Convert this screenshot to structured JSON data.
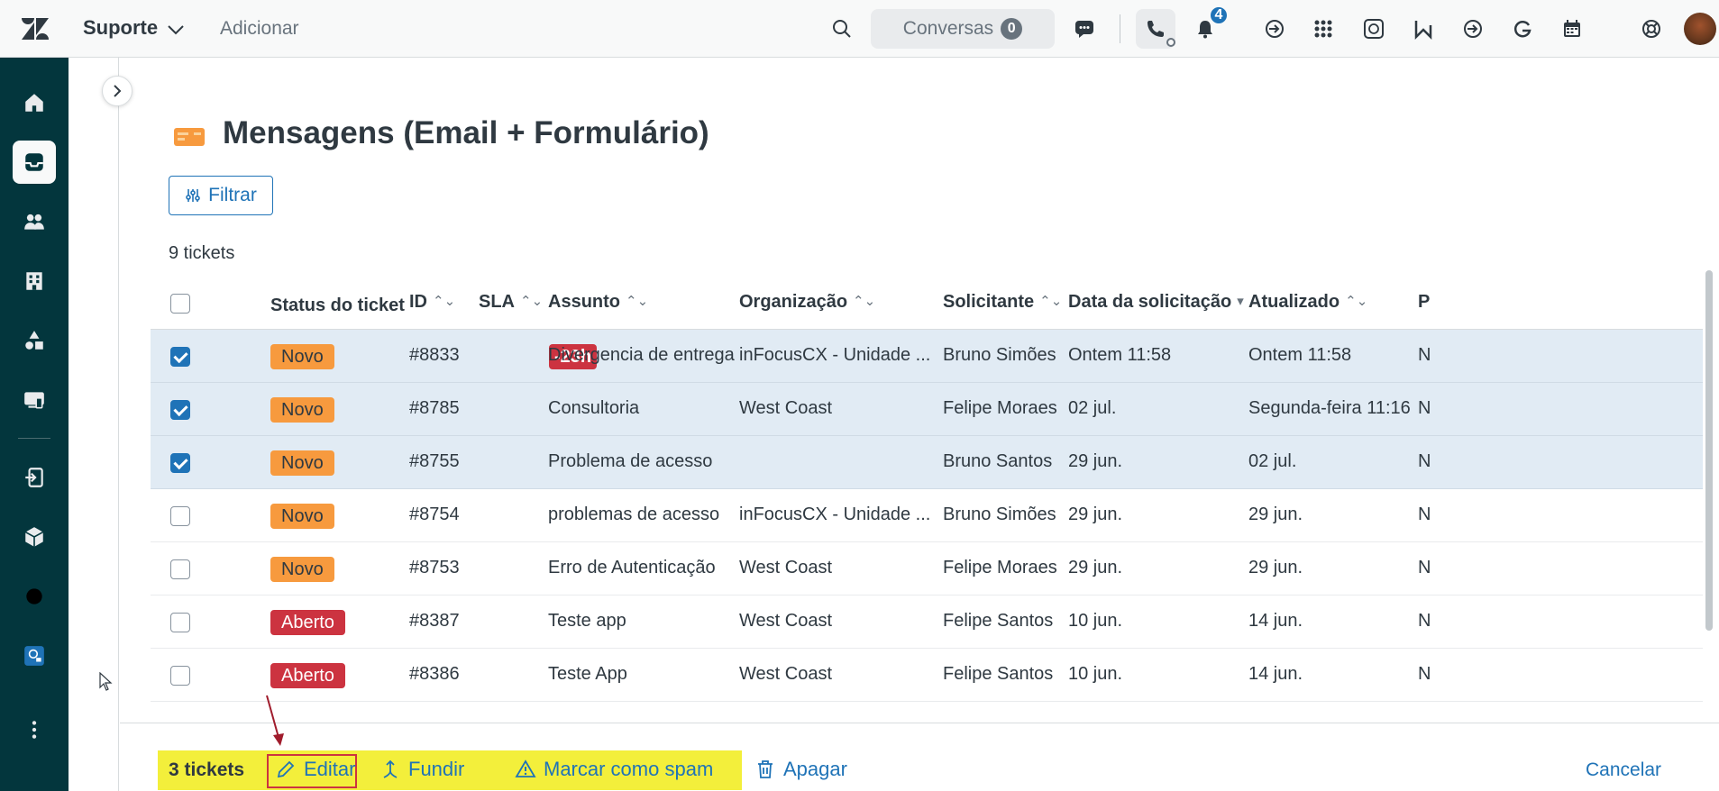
{
  "topbar": {
    "workspace": "Suporte",
    "add_label": "Adicionar",
    "conversations_label": "Conversas",
    "conversations_count": "0",
    "notifications_count": "4"
  },
  "view": {
    "title": "Mensagens (Email + Formulário)",
    "filter_label": "Filtrar",
    "ticket_count": "9 tickets"
  },
  "table": {
    "columns": [
      "Status do ticket",
      "ID",
      "SLA",
      "Assunto",
      "Organização",
      "Solicitante",
      "Data da solicitação",
      "Atualizado",
      "P"
    ],
    "rows": [
      {
        "selected": true,
        "status": "Novo",
        "id": "#8833",
        "sla": "-23h",
        "subject": "Divergencia de entrega",
        "org": "inFocusCX - Unidade ...",
        "requester": "Bruno Simões",
        "requested": "Ontem 11:58",
        "updated": "Ontem 11:58",
        "p": "N"
      },
      {
        "selected": true,
        "status": "Novo",
        "id": "#8785",
        "sla": "",
        "subject": "Consultoria",
        "org": "West Coast",
        "requester": "Felipe Moraes",
        "requested": "02 jul.",
        "updated": "Segunda-feira 11:16",
        "p": "N"
      },
      {
        "selected": true,
        "status": "Novo",
        "id": "#8755",
        "sla": "",
        "subject": "Problema de acesso",
        "org": "",
        "requester": "Bruno Santos",
        "requested": "29 jun.",
        "updated": "02 jul.",
        "p": "N"
      },
      {
        "selected": false,
        "status": "Novo",
        "id": "#8754",
        "sla": "",
        "subject": "problemas de acesso",
        "org": "inFocusCX - Unidade ...",
        "requester": "Bruno Simões",
        "requested": "29 jun.",
        "updated": "29 jun.",
        "p": "N"
      },
      {
        "selected": false,
        "status": "Novo",
        "id": "#8753",
        "sla": "",
        "subject": "Erro de Autenticação",
        "org": "West Coast",
        "requester": "Felipe Moraes",
        "requested": "29 jun.",
        "updated": "29 jun.",
        "p": "N"
      },
      {
        "selected": false,
        "status": "Aberto",
        "id": "#8387",
        "sla": "",
        "subject": "Teste app",
        "org": "West Coast",
        "requester": "Felipe Santos",
        "requested": "10 jun.",
        "updated": "14 jun.",
        "p": "N"
      },
      {
        "selected": false,
        "status": "Aberto",
        "id": "#8386",
        "sla": "",
        "subject": "Teste App",
        "org": "West Coast",
        "requester": "Felipe Santos",
        "requested": "10 jun.",
        "updated": "14 jun.",
        "p": "N"
      }
    ]
  },
  "bulk": {
    "count": "3 tickets",
    "edit": "Editar",
    "merge": "Fundir",
    "spam": "Marcar como spam",
    "delete": "Apagar",
    "cancel": "Cancelar"
  },
  "colors": {
    "nav_bg": "#03363d",
    "accent": "#1f73b7",
    "status_new": "#f79a3e",
    "status_open": "#cc3340",
    "highlight": "#f3ef3b"
  }
}
